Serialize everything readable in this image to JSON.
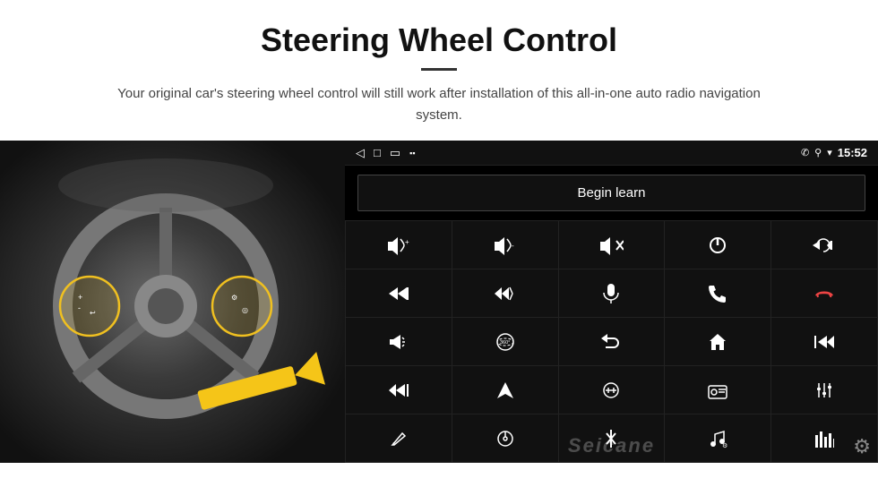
{
  "header": {
    "title": "Steering Wheel Control",
    "subtitle": "Your original car's steering wheel control will still work after installation of this all-in-one auto radio navigation system."
  },
  "android_panel": {
    "status_bar": {
      "back_icon": "◁",
      "home_icon": "□",
      "recent_icon": "▭",
      "signal_icon": "▪▪",
      "phone_icon": "✆",
      "location_icon": "⚲",
      "wifi_icon": "▾",
      "time": "15:52"
    },
    "begin_learn_label": "Begin learn",
    "grid_rows": [
      [
        {
          "icon": "vol+",
          "label": "Volume Up"
        },
        {
          "icon": "vol-",
          "label": "Volume Down"
        },
        {
          "icon": "mute",
          "label": "Mute"
        },
        {
          "icon": "power",
          "label": "Power"
        },
        {
          "icon": "prev_track",
          "label": "Previous Track"
        }
      ],
      [
        {
          "icon": "next",
          "label": "Next"
        },
        {
          "icon": "fast_fwd",
          "label": "Fast Forward"
        },
        {
          "icon": "mic",
          "label": "Microphone"
        },
        {
          "icon": "phone",
          "label": "Phone"
        },
        {
          "icon": "hang_up",
          "label": "Hang Up"
        }
      ],
      [
        {
          "icon": "horn",
          "label": "Horn"
        },
        {
          "icon": "360",
          "label": "360 View"
        },
        {
          "icon": "return",
          "label": "Return"
        },
        {
          "icon": "home",
          "label": "Home"
        },
        {
          "icon": "skip_back",
          "label": "Skip Back"
        }
      ],
      [
        {
          "icon": "skip_fwd",
          "label": "Skip Forward"
        },
        {
          "icon": "navigate",
          "label": "Navigate"
        },
        {
          "icon": "equalizer",
          "label": "Equalizer"
        },
        {
          "icon": "radio",
          "label": "Radio"
        },
        {
          "icon": "settings_sliders",
          "label": "Settings Sliders"
        }
      ],
      [
        {
          "icon": "pen",
          "label": "Pen"
        },
        {
          "icon": "media",
          "label": "Media"
        },
        {
          "icon": "bluetooth",
          "label": "Bluetooth"
        },
        {
          "icon": "music_note",
          "label": "Music Note"
        },
        {
          "icon": "equalizer_bars",
          "label": "Equalizer Bars"
        }
      ]
    ],
    "watermark": "Seicane"
  },
  "colors": {
    "panel_bg": "#000000",
    "grid_line": "#222222",
    "btn_bg": "#111111",
    "btn_text": "#ffffff",
    "accent_yellow": "#f5c518"
  }
}
